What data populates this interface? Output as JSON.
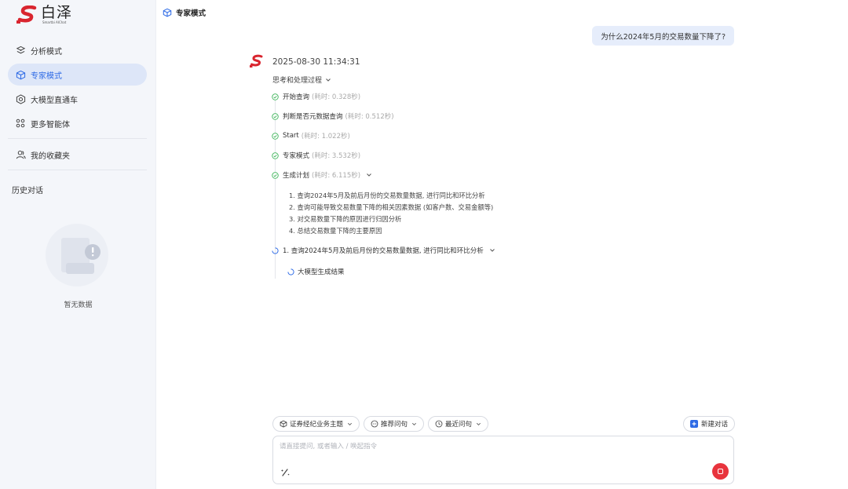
{
  "app": {
    "logo_cn": "白泽",
    "logo_en": "Smartbi AIChat"
  },
  "sidebar": {
    "items": [
      {
        "label": "分析模式",
        "icon": "analysis-icon"
      },
      {
        "label": "专家模式",
        "icon": "cube-icon",
        "active": true
      },
      {
        "label": "大模型直通车",
        "icon": "hexagon-icon"
      },
      {
        "label": "更多智能体",
        "icon": "grid-dots-icon"
      }
    ],
    "favorites_label": "我的收藏夹",
    "history_title": "历史对话",
    "empty_text": "暂无数据"
  },
  "header": {
    "mode_title": "专家模式"
  },
  "chat": {
    "user_question": "为什么2024年5月的交易数量下降了?",
    "ai_timestamp": "2025-08-30 11:34:31",
    "think_toggle_label": "思考和处理过程",
    "steps": [
      {
        "label": "开始查询",
        "cost": "(耗时: 0.328秒)"
      },
      {
        "label": "判断是否元数据查询",
        "cost": "(耗时: 0.512秒)"
      },
      {
        "label": "Start",
        "cost": "(耗时: 1.022秒)"
      },
      {
        "label": "专家模式",
        "cost": "(耗时: 3.532秒)"
      },
      {
        "label": "生成计划",
        "cost": "(耗时: 6.115秒)"
      }
    ],
    "plan": [
      "1. 查询2024年5月及前后月份的交易数量数据, 进行同比和环比分析",
      "2. 查询可能导致交易数量下降的相关因素数据 (如客户数、交易金额等)",
      "3. 对交易数量下降的原因进行归因分析",
      "4. 总结交易数量下降的主要原因"
    ],
    "running_step": "1. 查询2024年5月及前后月份的交易数量数据, 进行同比和环比分析",
    "running_substep": "大模型生成结果"
  },
  "composer": {
    "chips": [
      {
        "label": "证券经纪业务主题",
        "icon": "cube-icon"
      },
      {
        "label": "推荐问句",
        "icon": "chat-bubble-icon"
      },
      {
        "label": "最近问句",
        "icon": "clock-icon"
      }
    ],
    "new_chat_label": "新建对话",
    "placeholder": "请直接提问, 或者输入 / 唤起指令"
  },
  "colors": {
    "accent": "#2e6be6",
    "success": "#3fb55b",
    "stop": "#e8343d",
    "brand_red": "#d9252f"
  }
}
